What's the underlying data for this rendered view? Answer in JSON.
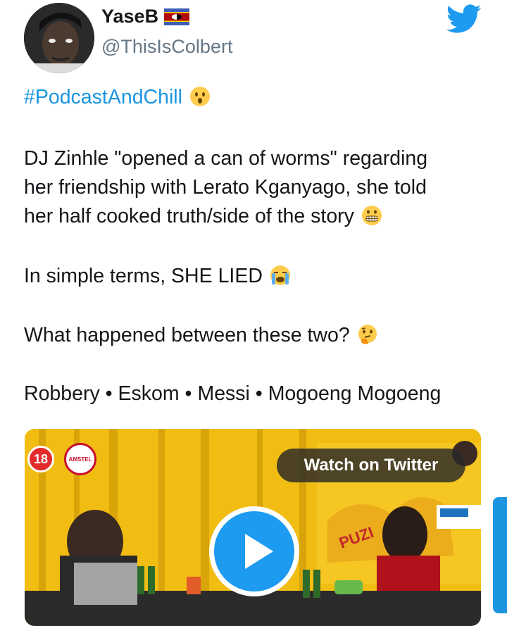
{
  "tweet": {
    "author": {
      "display_name": "YaseB",
      "handle": "@ThisIsColbert",
      "flag_emoji": "eswatini-flag"
    },
    "lines": {
      "hashtag": "#PodcastAndChill",
      "p1_l1": "DJ Zinhle \"opened a can of worms\" regarding",
      "p1_l2": "her friendship with Lerato Kganyago, she told",
      "p1_l3": "her half cooked truth/side of the story",
      "p2": "In simple terms, SHE LIED",
      "p3": "What happened between these two?",
      "p4": "Robbery • Eskom • Messi • Mogoeng Mogoeng"
    },
    "media": {
      "age_rating": "18",
      "brand_logo_text": "AMSTEL",
      "watch_label": "Watch on Twitter"
    }
  },
  "colors": {
    "link": "#1b95e0",
    "twitter_blue": "#1d9bf0",
    "text": "#14171a",
    "secondary": "#657786"
  },
  "icons": [
    "twitter-bird-icon",
    "hushed-face-emoji",
    "grimacing-face-emoji",
    "crying-face-emoji",
    "thinking-face-emoji",
    "play-icon"
  ]
}
